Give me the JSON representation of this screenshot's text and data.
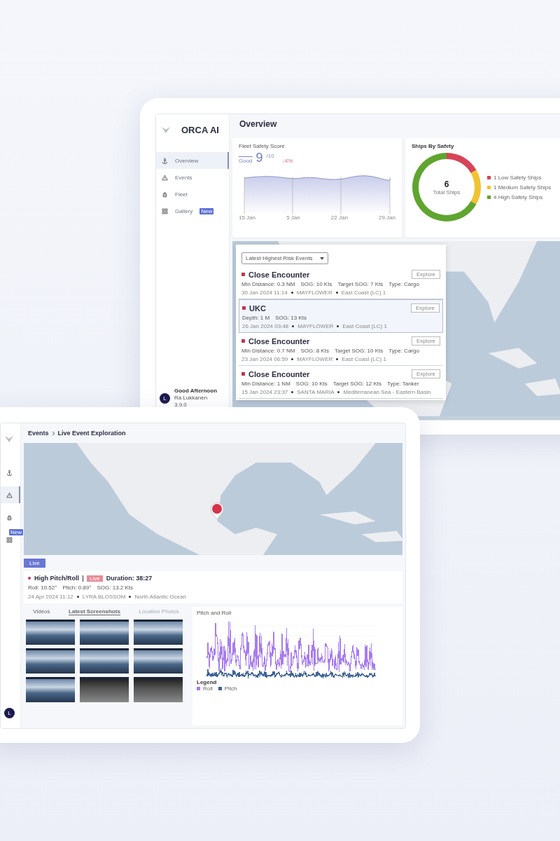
{
  "overview_app": {
    "brand": "ORCA AI",
    "page_title": "Overview",
    "nav": [
      {
        "label": "Overview",
        "selected": true
      },
      {
        "label": "Events",
        "selected": false
      },
      {
        "label": "Fleet",
        "selected": false
      },
      {
        "label": "Gallery",
        "selected": false,
        "badge": "New"
      }
    ],
    "user": {
      "initial": "L",
      "greeting": "Good Afternoon",
      "name": "Ra Lukkanen",
      "version": "3.9.0"
    },
    "fleet_score": {
      "title": "Fleet Safety Score",
      "rating": "Good",
      "score": "9",
      "out_of": "/10",
      "change": "↓4%",
      "x_labels": [
        "15 Jan",
        "5 Jan",
        "22 Jan",
        "29 Jan"
      ]
    },
    "ships_by_safety": {
      "title": "Ships By Safety",
      "total": "6",
      "total_label": "Total Ships",
      "chart_data": {
        "type": "donut",
        "categories": [
          "1 Low Safety Ships",
          "1 Medium Safety Ships",
          "4 High Safety Ships"
        ],
        "values": [
          1,
          1,
          4
        ]
      },
      "legend": [
        {
          "color": "#d64557"
        },
        {
          "color": "#f0c330"
        },
        {
          "color": "#5fa52f"
        }
      ]
    },
    "events_filter": "Latest Highest Risk Events",
    "events": [
      {
        "title": "Close Encounter",
        "selected": false,
        "details": [
          "Min Distance: 0.3 NM",
          "SOG: 10 Kts",
          "Target SOG: 7 Kts",
          "Type: Cargo"
        ],
        "meta": [
          "30 Jan 2024 11:14",
          "MAYFLOWER",
          "East Coast (LC) 1"
        ],
        "action": "Explore"
      },
      {
        "title": "UKC",
        "selected": true,
        "details": [
          "Depth: 1 M",
          "SOG: 13 Kts"
        ],
        "meta": [
          "26 Jan 2024 03:48",
          "MAYFLOWER",
          "East Coast (LC) 1"
        ],
        "action": "Explore"
      },
      {
        "title": "Close Encounter",
        "selected": false,
        "details": [
          "Min Distance: 0.7 NM",
          "SOG: 8 Kts",
          "Target SOG: 10 Kts",
          "Type: Cargo"
        ],
        "meta": [
          "23 Jan 2024 06:59",
          "MAYFLOWER",
          "East Coast (LC) 1"
        ],
        "action": "Explore"
      },
      {
        "title": "Close Encounter",
        "selected": false,
        "details": [
          "Min Distance: 1 NM",
          "SOG: 10 Kts",
          "Target SOG: 12 Kts",
          "Type: Tanker"
        ],
        "meta": [
          "15 Jan 2024 23:37",
          "SANTA MARIA",
          "Mediterranean Sea - Eastern Basin"
        ],
        "action": "Explore"
      }
    ]
  },
  "explore_app": {
    "breadcrumb": [
      "Events",
      "Live Event Exploration"
    ],
    "nav": [
      {
        "selected": false
      },
      {
        "selected": true
      },
      {
        "selected": false
      },
      {
        "selected": false,
        "badge": "New"
      }
    ],
    "user_initial": "L",
    "live_button": "Live",
    "event": {
      "title": "High Pitch/Roll",
      "tag": "Live",
      "duration": "Duration: 38:27",
      "details": [
        "Roll: 10.52°",
        "Pitch: 0.89°",
        "SOG: 13.2 Kts"
      ],
      "meta": [
        "24 Apr 2024 11:12",
        "LYRA BLOSSOM",
        "North Atlantic Ocean"
      ]
    },
    "media_tabs": [
      {
        "label": "Videos",
        "selected": false,
        "disabled": false
      },
      {
        "label": "Latest Screenshots",
        "selected": true,
        "disabled": false
      },
      {
        "label": "Location Photos",
        "selected": false,
        "disabled": true
      }
    ],
    "photos": [
      {
        "kind": "sea"
      },
      {
        "kind": "sea"
      },
      {
        "kind": "sea"
      },
      {
        "kind": "sea"
      },
      {
        "kind": "sea"
      },
      {
        "kind": "sea"
      },
      {
        "kind": "sea"
      },
      {
        "kind": "deck"
      },
      {
        "kind": "deck"
      }
    ],
    "chart": {
      "title": "Pitch and Roll",
      "legend_title": "Legend",
      "series": [
        {
          "name": "Roll",
          "color": "#a77cf0"
        },
        {
          "name": "Pitch",
          "color": "#3f6496"
        }
      ]
    }
  }
}
